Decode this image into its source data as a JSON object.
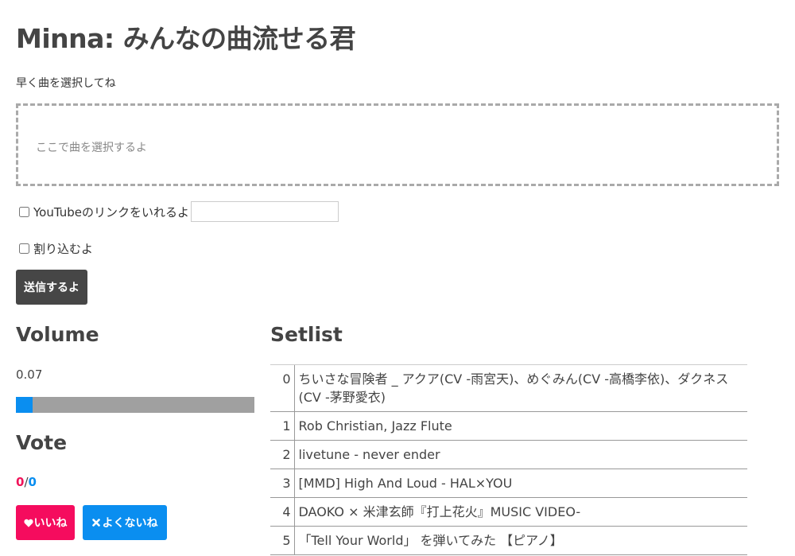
{
  "header": {
    "title": "Minna: みんなの曲流せる君"
  },
  "form": {
    "instruction": "早く曲を選択してね",
    "dropzone_text": "ここで曲を選択するよ",
    "youtube_label": "YouTubeのリンクをいれるよ",
    "youtube_value": "",
    "youtube_checked": false,
    "interrupt_label": "割り込むよ",
    "interrupt_checked": false,
    "submit_label": "送信するよ"
  },
  "volume": {
    "heading": "Volume",
    "value": "0.07",
    "level": 0.07
  },
  "vote": {
    "heading": "Vote",
    "like_count": "0",
    "separator": "/",
    "dislike_count": "0",
    "like_label": "いいね",
    "like_icon": "heart-icon",
    "dislike_label": "よくないね",
    "dislike_icon": "close-icon"
  },
  "setlist": {
    "heading": "Setlist",
    "items": [
      {
        "index": "0",
        "title": "ちいさな冒険者 _ アクア(CV -雨宮天)、めぐみん(CV -高橋李依)、ダクネス(CV -茅野愛衣)"
      },
      {
        "index": "1",
        "title": "Rob Christian, Jazz Flute"
      },
      {
        "index": "2",
        "title": "livetune - never ender"
      },
      {
        "index": "3",
        "title": "[MMD] High And Loud - HAL×YOU"
      },
      {
        "index": "4",
        "title": "DAOKO × 米津玄師『打上花火』MUSIC VIDEO-"
      },
      {
        "index": "5",
        "title": "「Tell Your World」 を弾いてみた 【ピアノ】"
      }
    ]
  },
  "colors": {
    "like": "#f50c5e",
    "dislike": "#0a8ef0",
    "submit": "#464646",
    "volume_fill": "#0a8ef0",
    "volume_track": "#a0a0a0"
  }
}
